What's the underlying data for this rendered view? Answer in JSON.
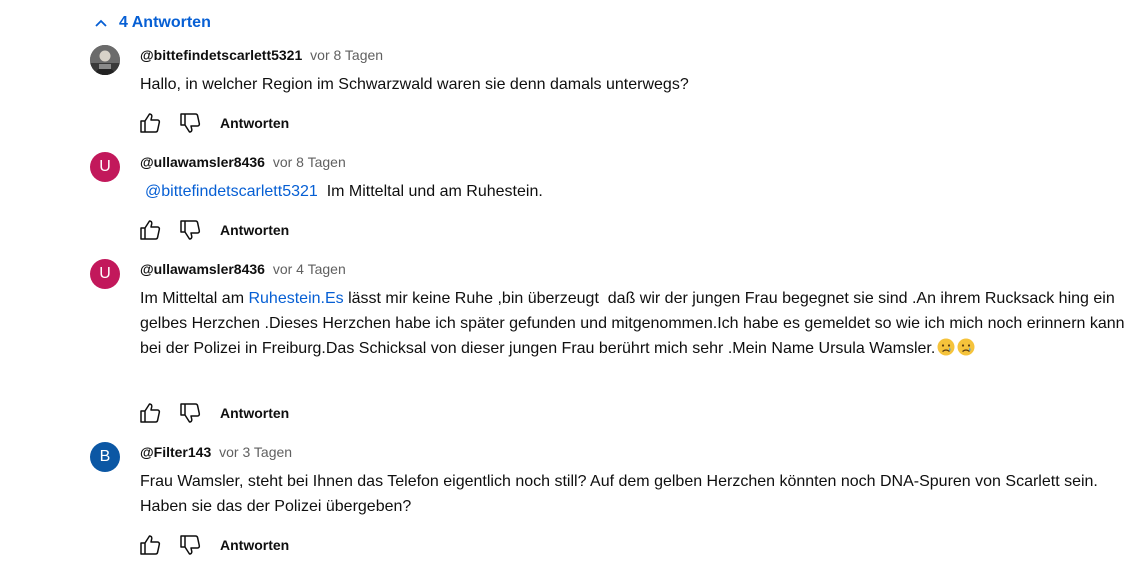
{
  "replies_toggle": {
    "label": "4 Antworten"
  },
  "comments": [
    {
      "author": "@bittefindetscarlett5321",
      "time": "vor 8 Tagen",
      "text": "Hallo, in welcher Region im Schwarzwald waren sie denn damals unterwegs?",
      "reply_label": "Antworten",
      "avatar": {
        "type": "photo"
      }
    },
    {
      "author": "@ullawamsler8436",
      "time": "vor 8 Tagen",
      "mention": "@bittefindetscarlett5321",
      "text": "Im Mitteltal und am Ruhestein.",
      "reply_label": "Antworten",
      "avatar": {
        "letter": "U",
        "color": "#c2185b"
      }
    },
    {
      "author": "@ullawamsler8436",
      "time": "vor 4 Tagen",
      "text_before": "Im Mitteltal am ",
      "link": "Ruhestein.Es",
      "text_after": " lässt mir keine Ruhe ,bin überzeugt  daß wir der jungen Frau begegnet sie sind .An ihrem Rucksack hing ein gelbes Herzchen .Dieses Herzchen habe ich später gefunden und mitgenommen.Ich habe es gemeldet so wie ich mich noch erinnern kann bei der Polizei in Freiburg.Das Schicksal von dieser jungen Frau berührt mich sehr .Mein Name Ursula Wamsler.",
      "emojis": [
        "crying-face",
        "crying-face"
      ],
      "reply_label": "Antworten",
      "avatar": {
        "letter": "U",
        "color": "#c2185b"
      }
    },
    {
      "author": "@Filter143",
      "time": "vor 3 Tagen",
      "text": "Frau Wamsler, steht bei Ihnen das Telefon eigentlich noch still? Auf dem gelben Herzchen könnten noch DNA-Spuren von Scarlett sein. Haben sie das der Polizei übergeben?",
      "reply_label": "Antworten",
      "avatar": {
        "letter": "B",
        "color": "#0b57a4"
      }
    }
  ]
}
